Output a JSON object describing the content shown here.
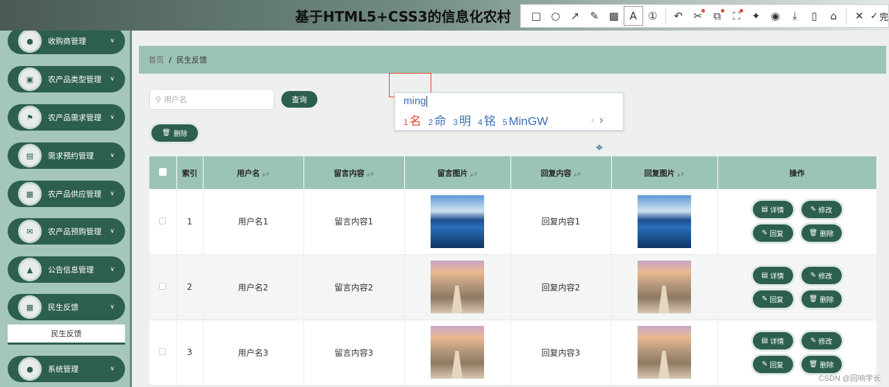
{
  "header": {
    "title": "基于HTML5+CSS3的信息化农村"
  },
  "toolbar": {
    "tools": [
      "rectangle-icon",
      "circle-icon",
      "arrow-icon",
      "pencil-icon",
      "mosaic-icon",
      "text-icon",
      "number-icon",
      "undo-icon",
      "scissors-icon",
      "ocr-icon",
      "scan-icon",
      "pin-icon",
      "record-icon",
      "download-icon",
      "phone-icon",
      "bookmark-icon",
      "close-icon"
    ],
    "finish_label": "完"
  },
  "sidebar": {
    "items": [
      {
        "label": "收购商管理",
        "icon": "person-icon"
      },
      {
        "label": "农产品类型管理",
        "icon": "monitor-icon"
      },
      {
        "label": "农产品需求管理",
        "icon": "flag-icon"
      },
      {
        "label": "需求预约管理",
        "icon": "document-icon"
      },
      {
        "label": "农产品供应管理",
        "icon": "grid-icon"
      },
      {
        "label": "农产品预购管理",
        "icon": "chat-icon"
      },
      {
        "label": "公告信息管理",
        "icon": "chart-icon"
      },
      {
        "label": "民生反馈",
        "icon": "grid-icon"
      },
      {
        "label": "系统管理",
        "icon": "person-icon"
      }
    ],
    "submenu_label": "民生反馈"
  },
  "breadcrumb": {
    "home": "首页",
    "separator": "/",
    "current": "民生反馈"
  },
  "search": {
    "placeholder": "用户名",
    "query_label": "查询",
    "delete_label": "删除"
  },
  "ime": {
    "input": "ming",
    "candidates": [
      {
        "num": "1",
        "text": "名"
      },
      {
        "num": "2",
        "text": "命"
      },
      {
        "num": "3",
        "text": "明"
      },
      {
        "num": "4",
        "text": "铭"
      },
      {
        "num": "5",
        "text": "MinGW"
      }
    ]
  },
  "table": {
    "headers": [
      "索引",
      "用户名",
      "留言内容",
      "留言图片",
      "回复内容",
      "回复图片",
      "操作"
    ],
    "rows": [
      {
        "index": "1",
        "username": "用户名1",
        "message": "留言内容1",
        "reply": "回复内容1"
      },
      {
        "index": "2",
        "username": "用户名2",
        "message": "留言内容2",
        "reply": "回复内容2"
      },
      {
        "index": "3",
        "username": "用户名3",
        "message": "留言内容3",
        "reply": "回复内容3"
      }
    ],
    "actions": {
      "detail": "详情",
      "edit": "修改",
      "reply": "回复",
      "delete": "删除"
    }
  },
  "watermark": "CSDN @回响学长",
  "colors": {
    "primary": "#2d5f4e",
    "header_bg": "#9cc4b4",
    "sidebar_bg": "#a4c7b9"
  }
}
